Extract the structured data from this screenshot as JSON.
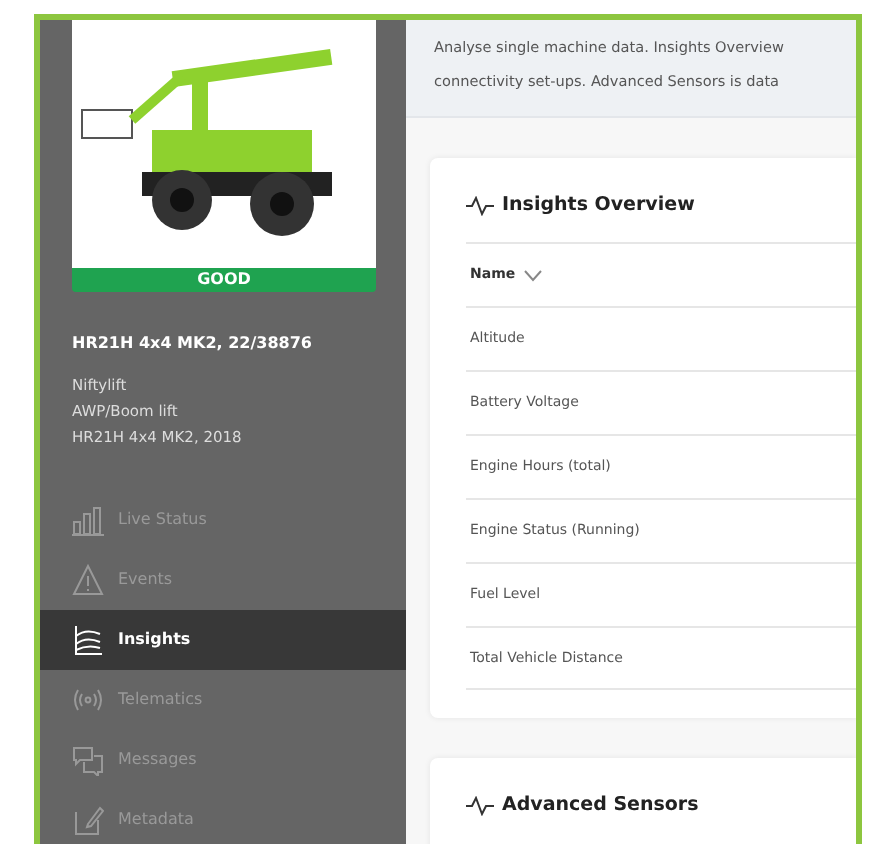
{
  "machine": {
    "status": "GOOD",
    "title": "HR21H 4x4 MK2, 22/38876",
    "details": [
      "Niftylift",
      "AWP/Boom lift",
      "HR21H 4x4 MK2, 2018"
    ]
  },
  "sidebar": {
    "items": [
      {
        "label": "Live Status",
        "selected": false
      },
      {
        "label": "Events",
        "selected": false
      },
      {
        "label": "Insights",
        "selected": true
      },
      {
        "label": "Telematics",
        "selected": false
      },
      {
        "label": "Messages",
        "selected": false
      },
      {
        "label": "Metadata",
        "selected": false
      }
    ]
  },
  "description": [
    "Analyse single machine data. Insights Overview",
    "connectivity set-ups. Advanced Sensors is data"
  ],
  "cards": [
    {
      "title": "Insights Overview",
      "table": {
        "columns": [
          "Name"
        ],
        "rows": [
          "Altitude",
          "Battery Voltage",
          "Engine Hours (total)",
          "Engine Status (Running)",
          "Fuel Level",
          "Total Vehicle Distance"
        ]
      }
    },
    {
      "title": "Advanced Sensors"
    }
  ]
}
